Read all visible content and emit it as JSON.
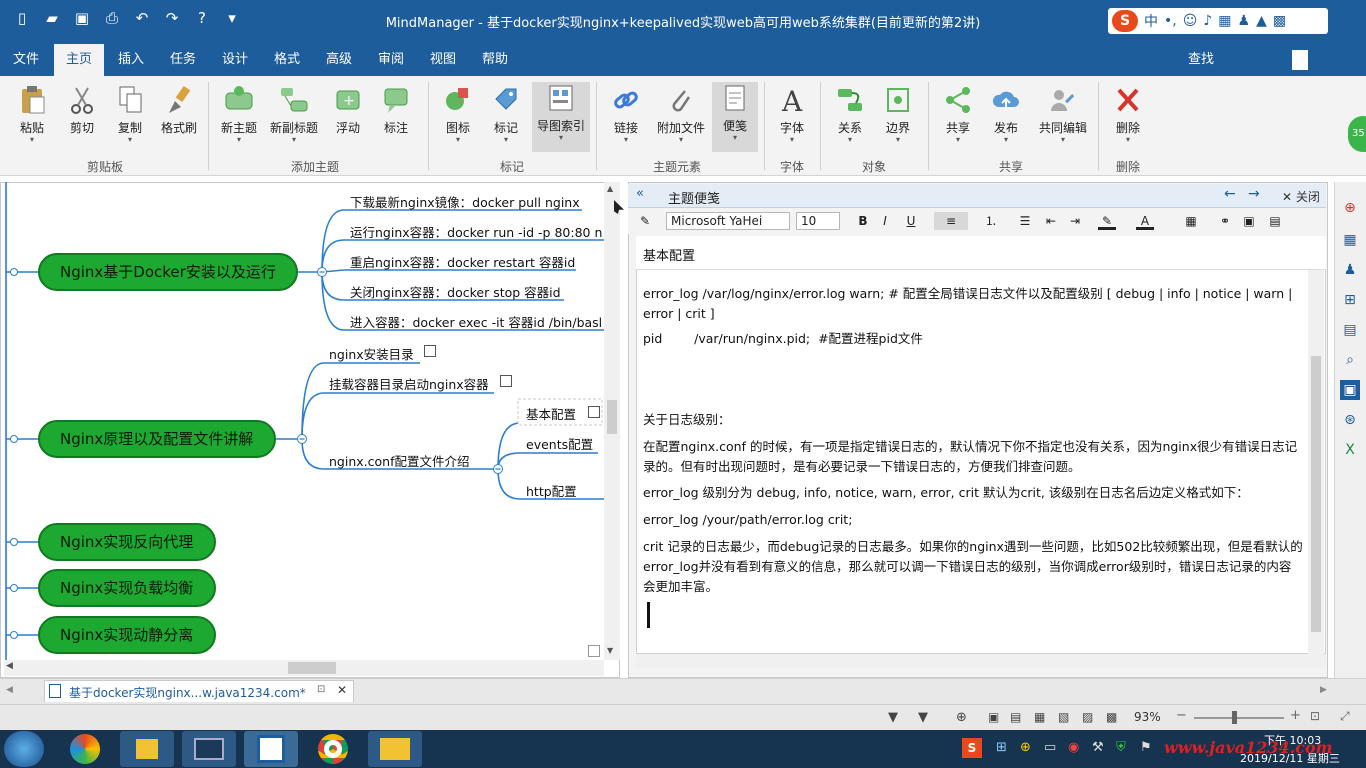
{
  "window": {
    "title": "MindManager - 基于docker实现nginx+keepalived实现web高可用web系统集群(目前更新的第2讲)"
  },
  "ime": {
    "logo": "S",
    "mode": "中"
  },
  "tabs": [
    {
      "label": "文件"
    },
    {
      "label": "主页"
    },
    {
      "label": "插入"
    },
    {
      "label": "任务"
    },
    {
      "label": "设计"
    },
    {
      "label": "格式"
    },
    {
      "label": "高级"
    },
    {
      "label": "审阅"
    },
    {
      "label": "视图"
    },
    {
      "label": "帮助"
    }
  ],
  "search": {
    "label": "查找"
  },
  "ribbon": {
    "buttons": [
      "粘贴",
      "剪切",
      "复制",
      "格式刷",
      "新主题",
      "新副标题",
      "浮动",
      "标注",
      "图标",
      "标记",
      "导图索引",
      "链接",
      "附加文件",
      "便笺",
      "字体",
      "关系",
      "边界",
      "共享",
      "发布",
      "共同编辑",
      "删除"
    ],
    "groups": [
      "剪贴板",
      "添加主题",
      "标记",
      "主题元素",
      "字体",
      "对象",
      "共享",
      "删除"
    ]
  },
  "map": {
    "topics": [
      "Nginx基于Docker安装以及运行",
      "Nginx原理以及配置文件讲解",
      "Nginx实现反向代理",
      "Nginx实现负载均衡",
      "Nginx实现动静分离"
    ],
    "docker_subs": [
      "下载最新nginx镜像：docker pull nginx",
      "运行nginx容器：docker run -id -p 80:80  n",
      "重启nginx容器：docker restart 容器id",
      "关闭nginx容器：docker stop 容器id",
      "进入容器：docker exec -it 容器id /bin/basl"
    ],
    "principle_subs": [
      "nginx安装目录",
      "挂载容器目录启动nginx容器",
      "nginx.conf配置文件介绍"
    ],
    "conf_subs": [
      "基本配置",
      "events配置",
      "http配置"
    ]
  },
  "notes": {
    "panel_title": "主题便笺",
    "close_label": "关闭",
    "font_name": "Microsoft YaHei",
    "font_size": "10",
    "heading": "基本配置",
    "paragraphs": [
      "error_log  /var/log/nginx/error.log warn;  # 配置全局错误日志文件以及配置级别 [ debug | info | notice | warn | error | crit ]",
      "pid        /var/run/nginx.pid;  #配置进程pid文件",
      "关于日志级别：",
      "在配置nginx.conf 的时候，有一项是指定错误日志的，默认情况下你不指定也没有关系，因为nginx很少有错误日志记录的。但有时出现问题时，是有必要记录一下错误日志的，方便我们排查问题。",
      "error_log 级别分为 debug, info, notice, warn, error, crit  默认为crit, 该级别在日志名后边定义格式如下：",
      "error_log  /your/path/error.log crit;",
      "crit 记录的日志最少，而debug记录的日志最多。如果你的nginx遇到一些问题，比如502比较频繁出现，但是看默认的error_log并没有看到有意义的信息，那么就可以调一下错误日志的级别，当你调成error级别时，错误日志记录的内容会更加丰富。"
    ]
  },
  "doc_tab": {
    "label": "基于docker实现nginx...w.java1234.com*"
  },
  "status": {
    "zoom": "93%"
  },
  "taskbar": {
    "time": "下午 10:03",
    "date": "2019/12/11 星期三",
    "watermark": "www.java1234.com"
  },
  "colors": {
    "accent": "#1e5d9c",
    "topic": "#1da831",
    "line": "#2a7fd0"
  }
}
